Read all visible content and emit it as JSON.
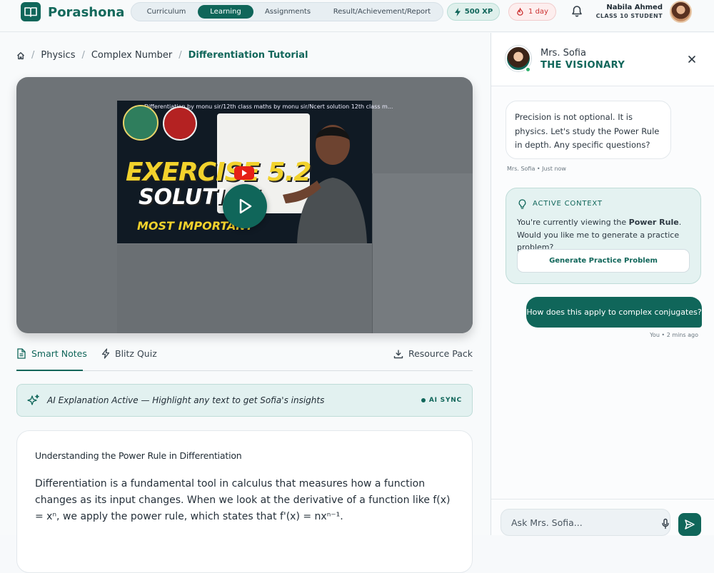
{
  "app": {
    "name": "Porashona"
  },
  "nav": {
    "items": [
      {
        "label": "Curriculum",
        "active": false
      },
      {
        "label": "Learning",
        "active": true
      },
      {
        "label": "Assignments",
        "active": false
      },
      {
        "label": "Result/Achievement/Report",
        "active": false
      }
    ]
  },
  "stats": {
    "xp": "500 XP",
    "streak": "1 day"
  },
  "user": {
    "name": "Nabila Ahmed",
    "subtitle": "CLASS 10 STUDENT"
  },
  "breadcrumb": [
    "Physics",
    "Complex Number",
    "Differentiation Tutorial"
  ],
  "video": {
    "title": "Differentiation by monu sir/12th class maths by monu sir/Ncert solution 12th class m...",
    "overlay_line1": "EXERCISE 5.2",
    "overlay_line2": "SOLUTION",
    "overlay_line3": "MOST IMPORTANT"
  },
  "tabs": [
    {
      "label": "Smart Notes",
      "active": true
    },
    {
      "label": "Blitz Quiz",
      "active": false
    }
  ],
  "resource_label": "Resource Pack",
  "ai_banner": {
    "text": "AI Explanation Active — Highlight any text to get Sofia's insights",
    "sync": "AI SYNC"
  },
  "notes": {
    "heading": "Understanding the Power Rule in Differentiation",
    "body": "Differentiation is a fundamental tool in calculus that measures how a function changes as its input changes. When we look at the derivative of a function like f(x) = xⁿ, we apply the power rule, which states that f'(x) = nxⁿ⁻¹."
  },
  "assistant": {
    "name": "Mrs. Sofia",
    "role": "THE VISIONARY",
    "messages": {
      "bot": "Precision is not optional. It is physics. Let's study the Power Rule in depth. Any specific questions?",
      "bot_meta": "Mrs. Sofia • Just now",
      "user": "How does this apply to complex conjugates?",
      "user_meta": "You • 2 mins ago"
    },
    "context": {
      "title": "ACTIVE CONTEXT",
      "text_before": "You're currently viewing the ",
      "text_bold": "Power Rule",
      "text_after": ". Would you like me to generate a practice problem?",
      "button": "Generate Practice Problem"
    },
    "input_placeholder": "Ask Mrs. Sofia..."
  },
  "colors": {
    "brand": "#10665a",
    "streak": "#cc3333",
    "online": "#2fb36f"
  }
}
